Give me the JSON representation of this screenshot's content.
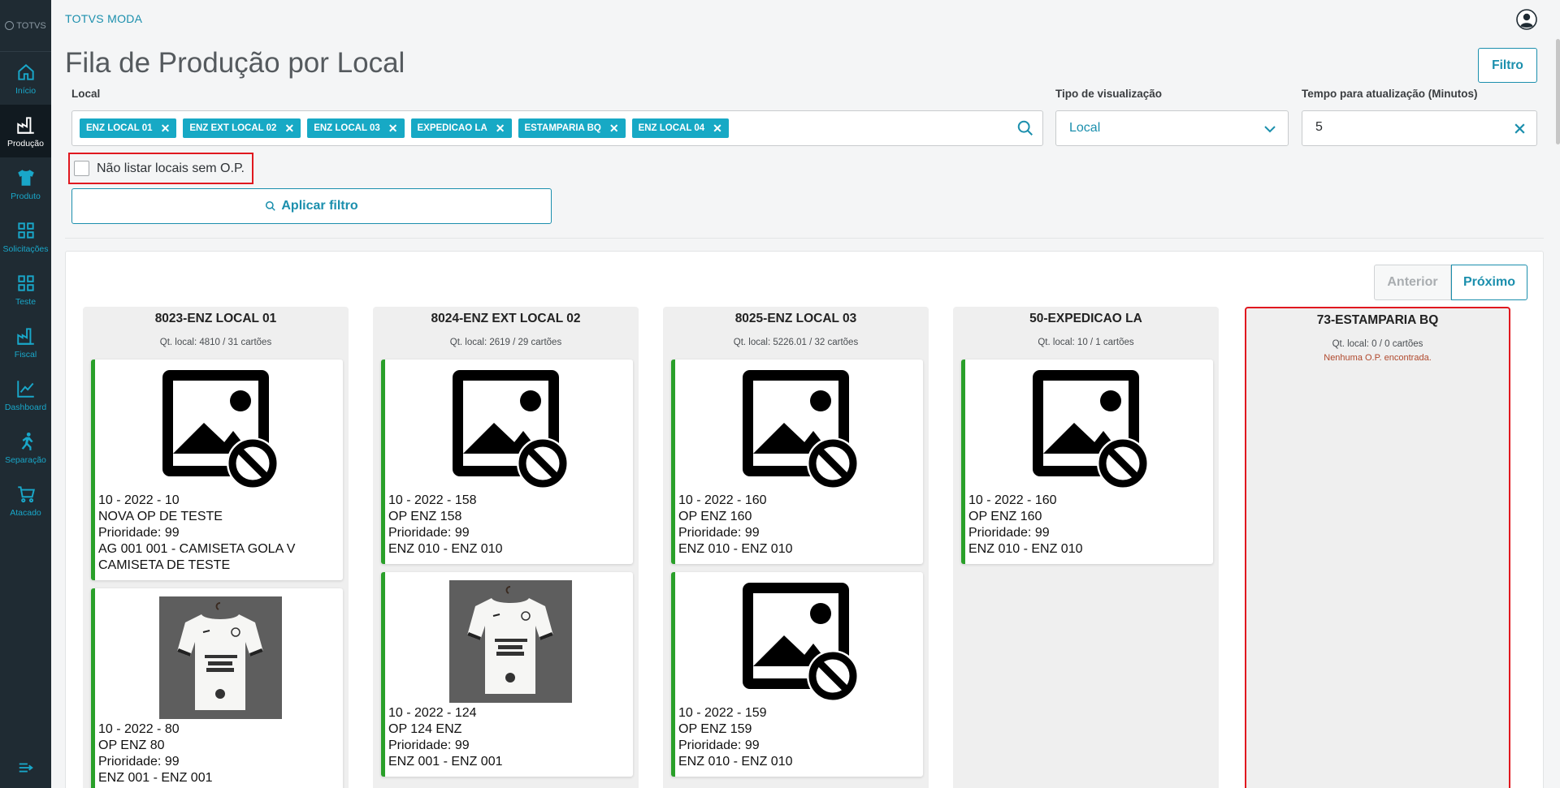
{
  "sidebar": {
    "logo": "TOTVS",
    "items": [
      {
        "label": "Início",
        "icon": "home-icon"
      },
      {
        "label": "Produção",
        "icon": "factory-icon",
        "active": true
      },
      {
        "label": "Produto",
        "icon": "shirt-icon"
      },
      {
        "label": "Solicitações",
        "icon": "grid-icon"
      },
      {
        "label": "Teste",
        "icon": "grid-icon"
      },
      {
        "label": "Fiscal",
        "icon": "factory-icon"
      },
      {
        "label": "Dashboard",
        "icon": "chart-icon"
      },
      {
        "label": "Separação",
        "icon": "runner-icon"
      },
      {
        "label": "Atacado",
        "icon": "cart-icon"
      }
    ],
    "collapse_icon": "collapse-menu-icon"
  },
  "header": {
    "app_name": "TOTVS MODA",
    "page_title": "Fila de Produção por Local",
    "filter_button": "Filtro"
  },
  "filters": {
    "local_label": "Local",
    "local_tags": [
      "ENZ LOCAL 01",
      "ENZ EXT LOCAL 02",
      "ENZ LOCAL 03",
      "EXPEDICAO LA",
      "ESTAMPARIA BQ",
      "ENZ LOCAL 04"
    ],
    "view_type_label": "Tipo de visualização",
    "view_type_value": "Local",
    "refresh_label": "Tempo para atualização (Minutos)",
    "refresh_value": "5",
    "checkbox_label": "Não listar locais sem O.P.",
    "checkbox_checked": false,
    "apply_button": "Aplicar filtro"
  },
  "pager": {
    "prev": "Anterior",
    "next": "Próximo"
  },
  "columns": [
    {
      "title": "8023-ENZ LOCAL 01",
      "subtitle": "Qt. local: 4810 / 31 cartões",
      "cards": [
        {
          "image": "no-image",
          "lines": [
            "10 - 2022 - 10",
            "NOVA OP DE TESTE",
            "Prioridade: 99",
            "AG 001 001 - CAMISETA GOLA V",
            "CAMISETA DE TESTE"
          ]
        },
        {
          "image": "shirt-photo",
          "lines": [
            "10 - 2022 - 80",
            "OP ENZ 80",
            "Prioridade: 99",
            "ENZ 001 - ENZ 001"
          ]
        }
      ]
    },
    {
      "title": "8024-ENZ EXT LOCAL 02",
      "subtitle": "Qt. local: 2619 / 29 cartões",
      "cards": [
        {
          "image": "no-image",
          "lines": [
            "10 - 2022 - 158",
            "OP ENZ 158",
            "Prioridade: 99",
            "ENZ 010 - ENZ 010"
          ]
        },
        {
          "image": "shirt-photo",
          "lines": [
            "10 - 2022 - 124",
            "OP 124 ENZ",
            "Prioridade: 99",
            "ENZ 001 - ENZ 001"
          ]
        }
      ]
    },
    {
      "title": "8025-ENZ LOCAL 03",
      "subtitle": "Qt. local: 5226.01 / 32 cartões",
      "cards": [
        {
          "image": "no-image",
          "lines": [
            "10 - 2022 - 160",
            "OP ENZ 160",
            "Prioridade: 99",
            "ENZ 010 - ENZ 010"
          ]
        },
        {
          "image": "no-image",
          "lines": [
            "10 - 2022 - 159",
            "OP ENZ 159",
            "Prioridade: 99",
            "ENZ 010 - ENZ 010"
          ]
        }
      ]
    },
    {
      "title": "50-EXPEDICAO LA",
      "subtitle": "Qt. local: 10 / 1 cartões",
      "cards": [
        {
          "image": "no-image",
          "lines": [
            "10 - 2022 - 160",
            "OP ENZ 160",
            "Prioridade: 99",
            "ENZ 010 - ENZ 010"
          ]
        }
      ]
    },
    {
      "title": "73-ESTAMPARIA BQ",
      "subtitle": "Qt. local: 0 / 0 cartões",
      "empty_message": "Nenhuma O.P. encontrada.",
      "cards": []
    }
  ],
  "colors": {
    "accent": "#1b8fad",
    "tag": "#17a9c5",
    "sidebar": "#1f2b33",
    "card_border": "#2aa02a",
    "highlight": "#e0181f"
  }
}
